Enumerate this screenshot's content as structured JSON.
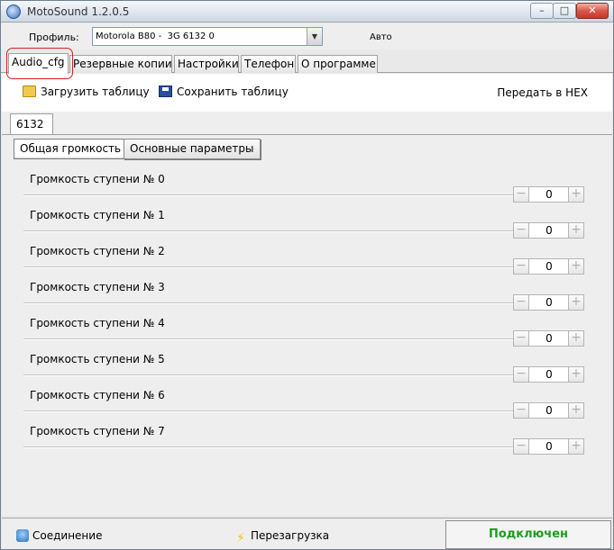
{
  "window": {
    "title": "MotoSound 1.2.0.5",
    "minimize": "–",
    "maximize": "□",
    "close": "✕"
  },
  "profile": {
    "label": "Профиль:",
    "value": "Motorola B80 -  3G 6132 0",
    "mode": "Авто"
  },
  "tabs": [
    {
      "label": "Audio_cfg",
      "active": true
    },
    {
      "label": "Резервные копии"
    },
    {
      "label": "Настройки"
    },
    {
      "label": "Телефон"
    },
    {
      "label": "О программе"
    }
  ],
  "toolbar": {
    "load": "Загрузить таблицу",
    "save": "Сохранить таблицу",
    "hex": "Передать в HEX"
  },
  "model_tab": "6132",
  "subtabs": {
    "volume": "Общая громкость",
    "params": "Основные параметры"
  },
  "spin": {
    "minus": "−",
    "plus": "+"
  },
  "volume_steps": [
    {
      "label": "Громкость ступени № 0",
      "value": "0"
    },
    {
      "label": "Громкость ступени № 1",
      "value": "0"
    },
    {
      "label": "Громкость ступени № 2",
      "value": "0"
    },
    {
      "label": "Громкость ступени № 3",
      "value": "0"
    },
    {
      "label": "Громкость ступени № 4",
      "value": "0"
    },
    {
      "label": "Громкость ступени № 5",
      "value": "0"
    },
    {
      "label": "Громкость ступени № 6",
      "value": "0"
    },
    {
      "label": "Громкость ступени № 7",
      "value": "0"
    }
  ],
  "status": {
    "connection": "Соединение",
    "reboot": "Перезагрузка",
    "state": "Подключен",
    "state_color": "#1f9b1f"
  },
  "icons": {
    "app": "motosound-icon",
    "load": "open-folder-icon",
    "save": "floppy-disk-icon",
    "connection": "connection-icon",
    "reboot": "lightning-icon"
  }
}
